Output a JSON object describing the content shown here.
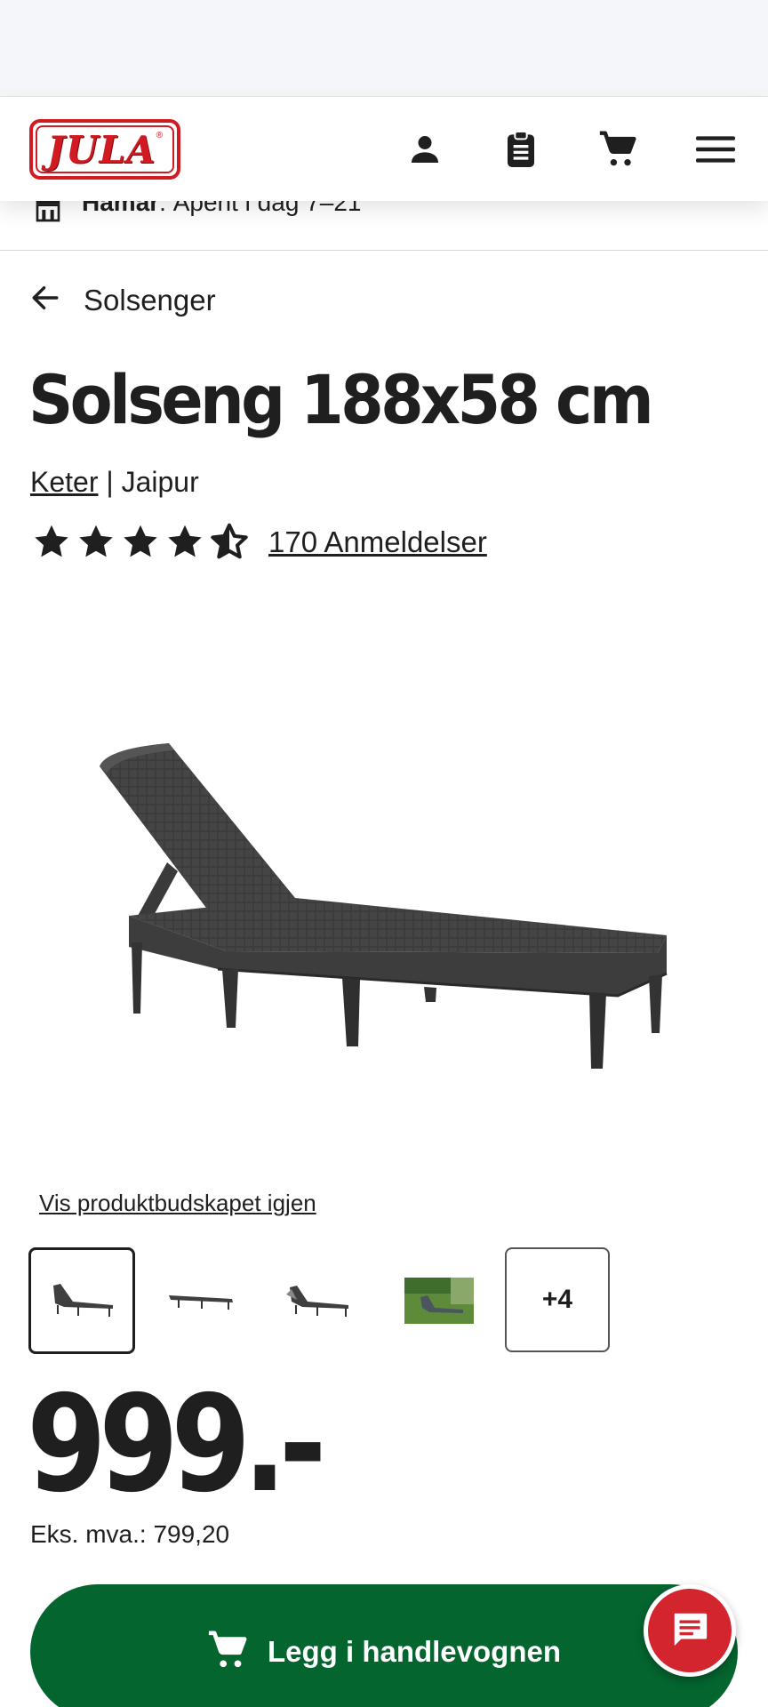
{
  "header": {
    "logo_text": "JULA",
    "logo_mark": "®",
    "icons": [
      "account-icon",
      "clipboard-icon",
      "cart-icon",
      "menu-icon"
    ]
  },
  "store": {
    "name": "Hamar",
    "hours": ": Åpent i dag 7–21"
  },
  "breadcrumb": {
    "back_label": "Solsenger"
  },
  "product": {
    "title": "Solseng 188x58 cm",
    "brand": "Keter",
    "separator": " | ",
    "series": "Jaipur",
    "rating": 4.5,
    "rating_max": 5,
    "reviews_label": "170 Anmeldelser",
    "restore_label": "Vis produktbudskapet igjen",
    "thumbnails": [
      "lounger-angled",
      "lounger-flat",
      "lounger-side",
      "lounger-garden"
    ],
    "more_images_label": "+4",
    "price": "999.-",
    "ex_vat_label": "Eks. mva.: 799,20"
  },
  "actions": {
    "add_to_cart_label": "Legg i handlevognen",
    "chat_icon": "chat-icon"
  },
  "colors": {
    "brand_red": "#d21a22",
    "cart_green": "#04652f",
    "chat_red": "#d3252d",
    "text": "#1f1f1f"
  }
}
